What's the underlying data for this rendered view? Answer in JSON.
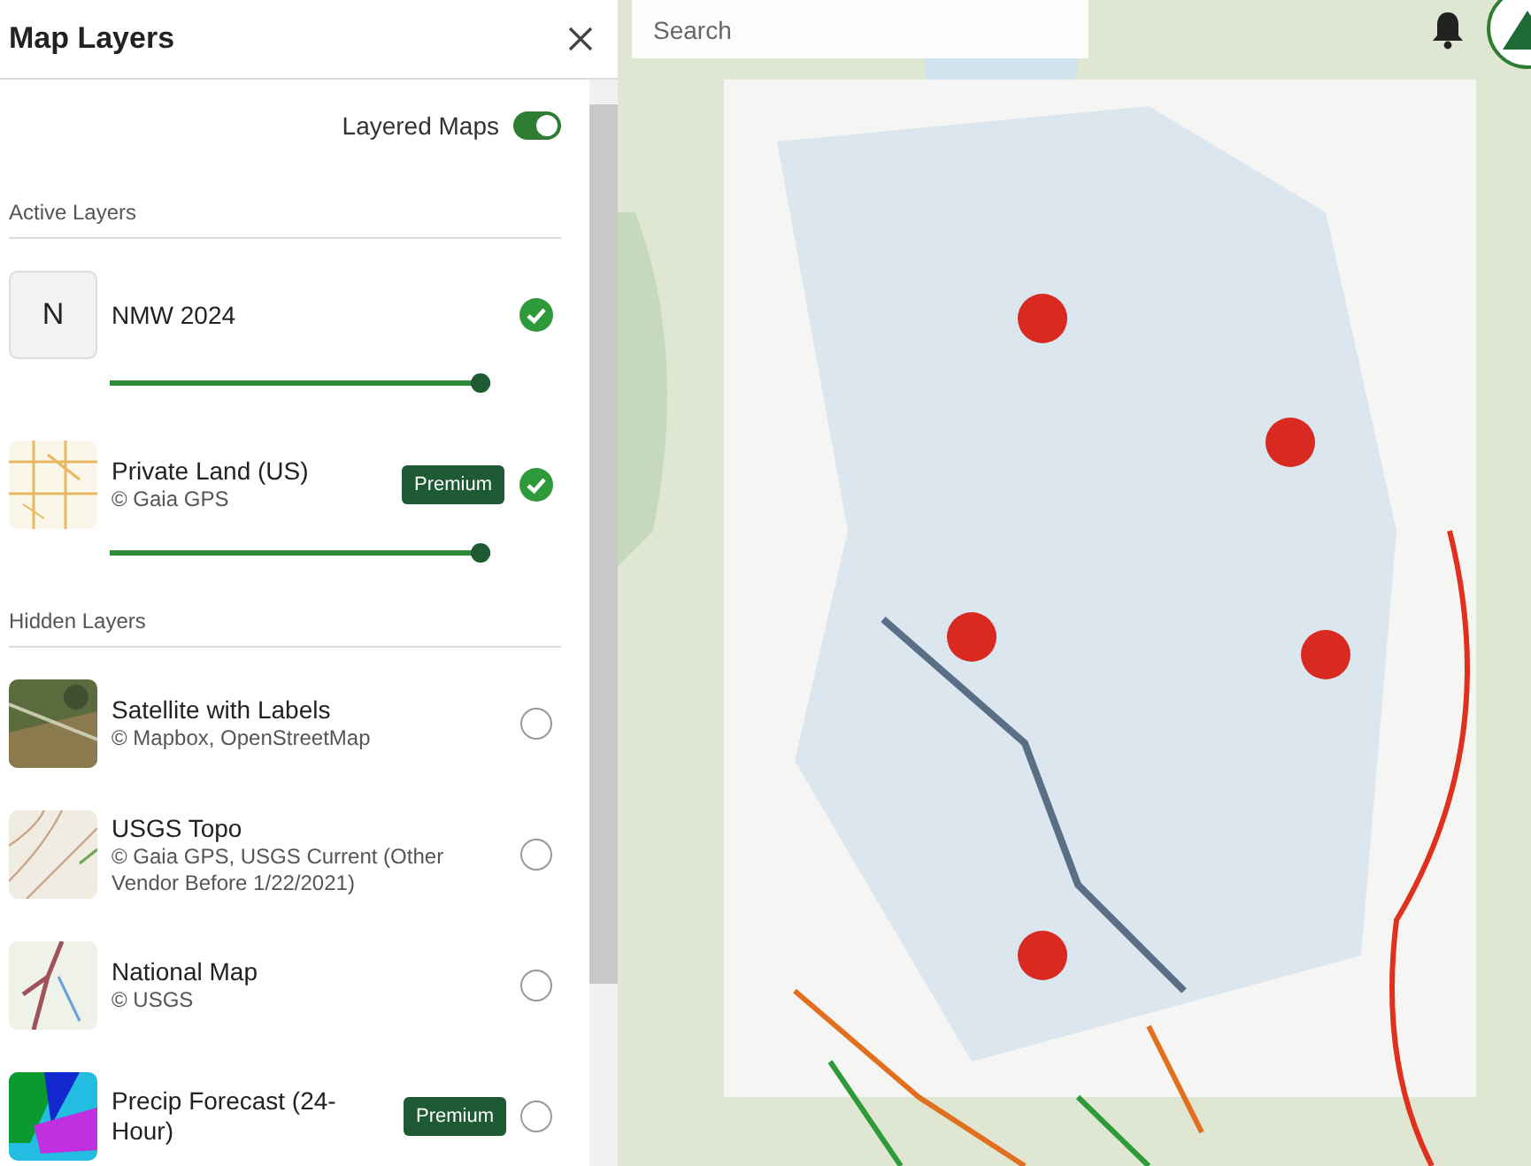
{
  "panel": {
    "title": "Map Layers",
    "layered_maps": {
      "label": "Layered Maps",
      "on": true
    },
    "sections": [
      {
        "heading": "Active Layers",
        "layers": [
          {
            "name": "NMW 2024",
            "thumbnail": {
              "kind": "letter",
              "text": "N"
            },
            "visible": true,
            "level": 1.0
          },
          {
            "name": "Private Land (US)",
            "attribution": "© Gaia GPS",
            "badge": "Premium",
            "visible": true,
            "level": 1.0
          }
        ]
      },
      {
        "heading": "Hidden Layers",
        "layers": [
          {
            "name": "Satellite with Labels",
            "attribution": "© Mapbox, OpenStreetMap",
            "visible": false
          },
          {
            "name": "USGS Topo",
            "attribution": "© Gaia GPS, USGS Current (Other Vendor Before 1/22/2021)",
            "visible": false
          },
          {
            "name": "National Map",
            "attribution": "© USGS",
            "visible": false
          },
          {
            "name": "Precip Forecast (24-Hour)",
            "badge": "Premium",
            "visible": false
          }
        ]
      }
    ]
  },
  "map": {
    "search": {
      "placeholder": "Search"
    }
  }
}
